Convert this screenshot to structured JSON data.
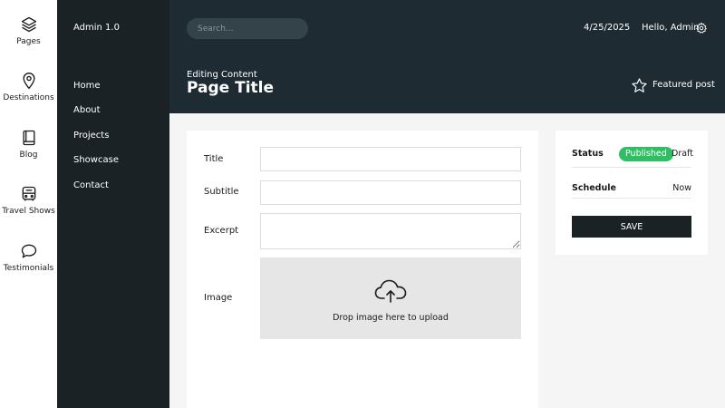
{
  "rail": {
    "items": [
      {
        "label": "Pages",
        "icon": "layers-icon"
      },
      {
        "label": "Destinations",
        "icon": "map-pin-icon"
      },
      {
        "label": "Blog",
        "icon": "book-icon"
      },
      {
        "label": "Travel Shows",
        "icon": "bus-icon"
      },
      {
        "label": "Testimonials",
        "icon": "chat-bubble-icon"
      }
    ]
  },
  "nav": {
    "brand": "Admin 1.0",
    "items": [
      "Home",
      "About",
      "Projects",
      "Showcase",
      "Contact"
    ]
  },
  "header": {
    "search_placeholder": "Search...",
    "date": "4/25/2025",
    "greeting": "Hello, Admin",
    "subtitle": "Editing Content",
    "title": "Page Title",
    "featured_label": "Featured post"
  },
  "form": {
    "title_label": "Title",
    "title_value": "",
    "subtitle_label": "Subtitle",
    "subtitle_value": "",
    "excerpt_label": "Excerpt",
    "excerpt_value": "",
    "image_label": "Image",
    "dropzone_text": "Drop image here to upload"
  },
  "side": {
    "status_label": "Status",
    "status_published": "Published",
    "status_draft": "Draft",
    "schedule_label": "Schedule",
    "schedule_value": "Now",
    "save_label": "SAVE"
  },
  "colors": {
    "nav_bg": "#1b2226",
    "header_bg": "#1e2b32",
    "published_pill": "#2fbf63",
    "save_button": "#1b2226"
  }
}
